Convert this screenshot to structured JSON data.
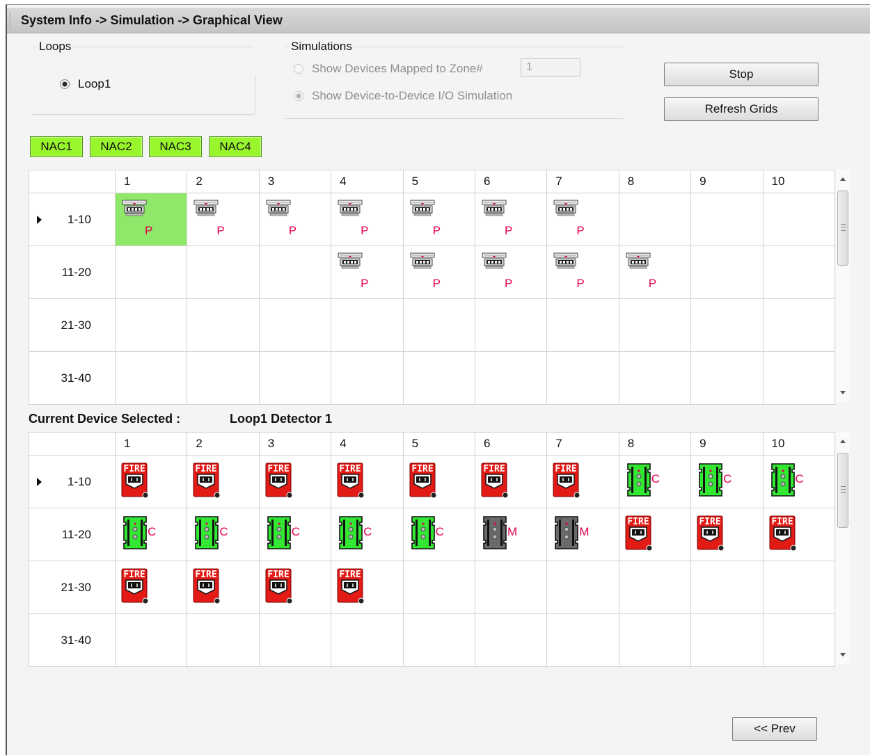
{
  "title": "System Info -> Simulation -> Graphical View",
  "loops": {
    "title": "Loops",
    "items": [
      {
        "label": "Loop1",
        "selected": true
      }
    ]
  },
  "simulations": {
    "title": "Simulations",
    "option_zone_label": "Show Devices Mapped to Zone#",
    "zone_value": "1",
    "option_io_label": "Show Device-to-Device I/O Simulation"
  },
  "buttons": {
    "stop": "Stop",
    "refresh": "Refresh Grids",
    "prev": "<< Prev"
  },
  "nacs": [
    "NAC1",
    "NAC2",
    "NAC3",
    "NAC4"
  ],
  "nac_color": "#99f52c",
  "detector_grid": {
    "columns": [
      "1",
      "2",
      "3",
      "4",
      "5",
      "6",
      "7",
      "8",
      "9",
      "10"
    ],
    "rows": [
      {
        "label": "1-10",
        "current": true,
        "cells": [
          "P",
          "P",
          "P",
          "P",
          "P",
          "P",
          "P",
          "",
          "",
          ""
        ]
      },
      {
        "label": "11-20",
        "cells": [
          "",
          "",
          "",
          "P",
          "P",
          "P",
          "P",
          "P",
          "",
          ""
        ]
      },
      {
        "label": "21-30",
        "cells": [
          "",
          "",
          "",
          "",
          "",
          "",
          "",
          "",
          "",
          ""
        ]
      },
      {
        "label": "31-40",
        "cells": [
          "",
          "",
          "",
          "",
          "",
          "",
          "",
          "",
          "",
          ""
        ]
      }
    ],
    "selected_cell": {
      "row": 0,
      "col": 0
    },
    "device_icon": "smoke-detector-icon"
  },
  "current_device": {
    "label": "Current Device Selected :",
    "value": "Loop1 Detector 1"
  },
  "module_grid": {
    "columns": [
      "1",
      "2",
      "3",
      "4",
      "5",
      "6",
      "7",
      "8",
      "9",
      "10"
    ],
    "rows": [
      {
        "label": "1-10",
        "current": true,
        "cells": [
          "fire",
          "fire",
          "fire",
          "fire",
          "fire",
          "fire",
          "fire",
          "C",
          "C",
          "C"
        ]
      },
      {
        "label": "11-20",
        "cells": [
          "C",
          "C",
          "C",
          "C",
          "C",
          "M",
          "M",
          "fire",
          "fire",
          "fire"
        ]
      },
      {
        "label": "21-30",
        "cells": [
          "fire",
          "fire",
          "fire",
          "fire",
          "",
          "",
          "",
          "",
          "",
          ""
        ]
      },
      {
        "label": "31-40",
        "cells": [
          "",
          "",
          "",
          "",
          "",
          "",
          "",
          "",
          "",
          ""
        ]
      }
    ],
    "fire_text": "FIRE",
    "colors": {
      "pull_station": "#e21b17",
      "control_module": "#33e833",
      "monitor_module": "#6a6a6a",
      "letter": "#e3004f"
    }
  }
}
